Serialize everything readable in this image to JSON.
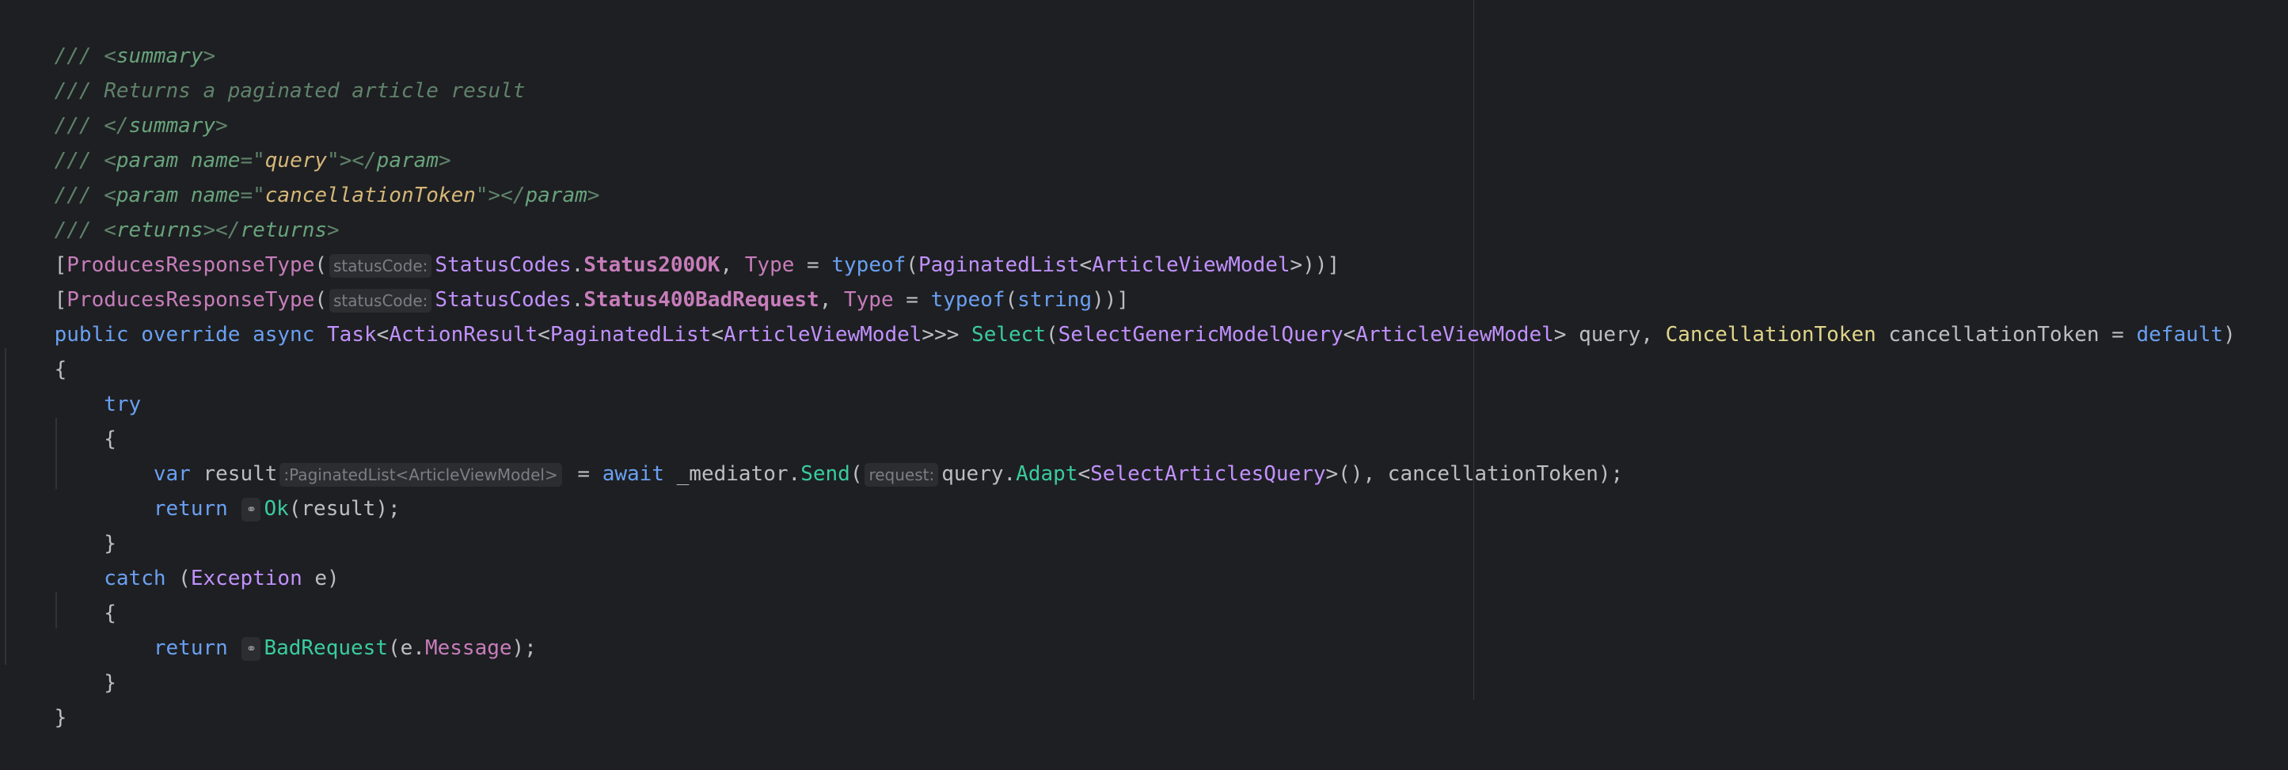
{
  "editor": {
    "language": "C#",
    "lines": {
      "l1": {
        "p1": "/// <",
        "p2": "summary",
        "p3": ">"
      },
      "l2": {
        "p1": "/// Returns a paginated article result"
      },
      "l3": {
        "p1": "/// </",
        "p2": "summary",
        "p3": ">"
      },
      "l4": {
        "p1": "/// <",
        "p2": "param ",
        "p3": "name",
        "p4": "=\"",
        "p5": "query",
        "p6": "\"></",
        "p7": "param",
        "p8": ">"
      },
      "l5": {
        "p1": "/// <",
        "p2": "param ",
        "p3": "name",
        "p4": "=\"",
        "p5": "cancellationToken",
        "p6": "\"></",
        "p7": "param",
        "p8": ">"
      },
      "l6": {
        "p1": "/// <",
        "p2": "returns",
        "p3": "></",
        "p4": "returns",
        "p5": ">"
      },
      "l7": {
        "p1": "[",
        "p2": "ProducesResponseType",
        "p3": "(",
        "hint": "statusCode:",
        "p4": "StatusCodes",
        "p5": ".",
        "p6": "Status200OK",
        "p7": ", ",
        "p8": "Type",
        "p9": " = ",
        "p10": "typeof",
        "p11": "(",
        "p12": "PaginatedList",
        "p13": "<",
        "p14": "ArticleViewModel",
        "p15": ">))]"
      },
      "l8": {
        "p1": "[",
        "p2": "ProducesResponseType",
        "p3": "(",
        "hint": "statusCode:",
        "p4": "StatusCodes",
        "p5": ".",
        "p6": "Status400BadRequest",
        "p7": ", ",
        "p8": "Type",
        "p9": " = ",
        "p10": "typeof",
        "p11": "(",
        "p12": "string",
        "p13": "))]"
      },
      "l9": {
        "p1": "public",
        "p2": " ",
        "p3": "override",
        "p4": " ",
        "p5": "async",
        "p6": " ",
        "p7": "Task",
        "p8": "<",
        "p9": "ActionResult",
        "p10": "<",
        "p11": "PaginatedList",
        "p12": "<",
        "p13": "ArticleViewModel",
        "p14": ">>> ",
        "p15": "Select",
        "p16": "(",
        "p17": "SelectGenericModelQuery",
        "p18": "<",
        "p19": "ArticleViewModel",
        "p20": "> query, ",
        "p21": "CancellationToken",
        "p22": " cancellationToken = ",
        "p23": "default",
        "p24": ")"
      },
      "l10": {
        "p1": "{"
      },
      "l11": {
        "p1": "    ",
        "p2": "try"
      },
      "l12": {
        "p1": "    {"
      },
      "l13": {
        "p1": "        ",
        "p2": "var",
        "p3": " result",
        "hint": ":PaginatedList<ArticleViewModel>",
        "p4": " = ",
        "p5": "await",
        "p6": " _mediator",
        "p7": ".",
        "p8": "Send",
        "p9": "(",
        "hint2": "request:",
        "p10": "query",
        "p11": ".",
        "p12": "Adapt",
        "p13": "<",
        "p14": "SelectArticlesQuery",
        "p15": ">(), cancellationToken);"
      },
      "l14": {
        "p1": "        ",
        "p2": "return",
        "p3": " ",
        "icon": "⚭",
        "p4": "Ok",
        "p5": "(result);"
      },
      "l15": {
        "p1": "    }"
      },
      "l16": {
        "p1": "    ",
        "p2": "catch",
        "p3": " (",
        "p4": "Exception",
        "p5": " e)"
      },
      "l17": {
        "p1": "    {"
      },
      "l18": {
        "p1": "        ",
        "p2": "return",
        "p3": " ",
        "icon": "⚭",
        "p4": "BadRequest",
        "p5": "(e.",
        "p6": "Message",
        "p7": ");"
      },
      "l19": {
        "p1": "    }"
      },
      "l20": {
        "p1": "}"
      }
    }
  }
}
